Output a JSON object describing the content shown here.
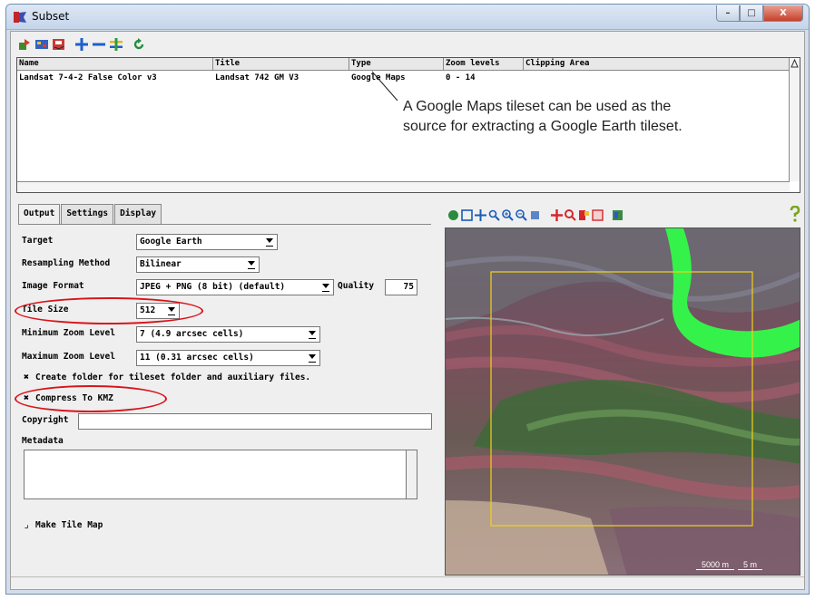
{
  "window": {
    "title": "Subset",
    "controls": {
      "minimize": "–",
      "maximize": "□",
      "close": "X"
    }
  },
  "toolbar": {
    "icons": [
      "new-tileset-icon",
      "open-icon",
      "save-icon",
      "add-icon",
      "remove-icon",
      "insert-icon",
      "refresh-icon"
    ]
  },
  "table": {
    "columns": [
      "Name",
      "Title",
      "Type",
      "Zoom levels",
      "Clipping Area"
    ],
    "rows": [
      {
        "name": "Landsat 7-4-2 False Color v3",
        "title": "Landsat 742 GM V3",
        "type": "Google Maps",
        "zoom": "0 - 14",
        "clip": ""
      }
    ]
  },
  "annotation": {
    "line1": "A Google Maps tileset can be used as the",
    "line2": "source for extracting a Google Earth tileset."
  },
  "tabs": [
    "Output",
    "Settings",
    "Display"
  ],
  "output": {
    "target_label": "Target",
    "target_value": "Google Earth",
    "resampling_label": "Resampling Method",
    "resampling_value": "Bilinear",
    "format_label": "Image Format",
    "format_value": "JPEG + PNG (8 bit) (default)",
    "quality_label": "Quality",
    "quality_value": "75",
    "tile_size_label": "Tile Size",
    "tile_size_value": "512",
    "min_zoom_label": "Minimum Zoom Level",
    "min_zoom_value": "7 (4.9 arcsec cells)",
    "max_zoom_label": "Maximum Zoom Level",
    "max_zoom_value": "11 (0.31 arcsec cells)",
    "create_folder_label": "Create folder for tileset folder and auxiliary files.",
    "create_folder_checked": true,
    "compress_label": "Compress To KMZ",
    "compress_checked": true,
    "copyright_label": "Copyright",
    "copyright_value": "",
    "metadata_label": "Metadata",
    "metadata_value": "",
    "tile_map_label": "Make Tile Map",
    "tile_map_checked": false
  },
  "view": {
    "scale_left": "5000 m",
    "scale_right": "5 m",
    "highlight_color": "#d9141b",
    "extent_color": "#f2d21a",
    "river_color": "#35f24a"
  }
}
